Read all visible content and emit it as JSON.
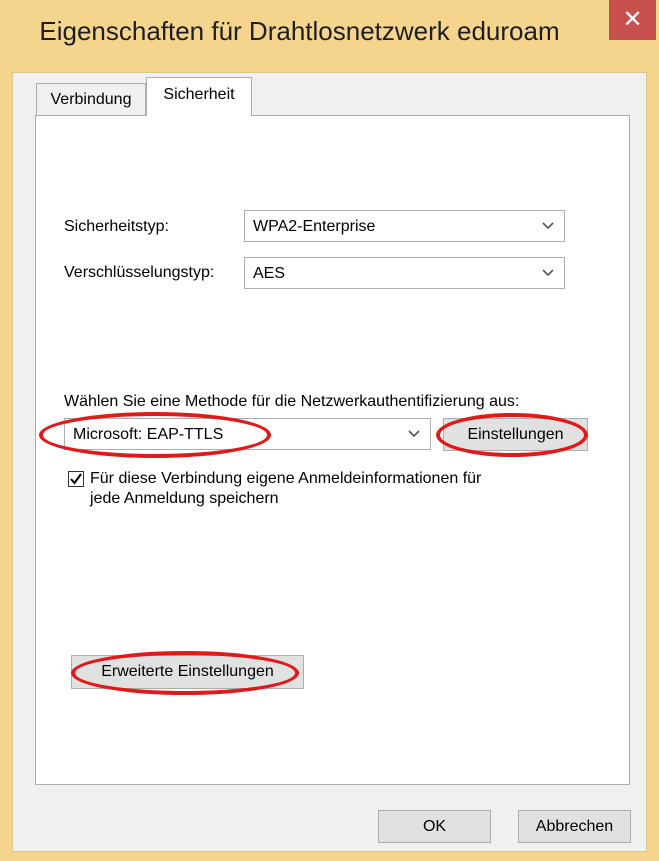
{
  "window": {
    "title": "Eigenschaften für Drahtlosnetzwerk eduroam",
    "close_glyph": "✕"
  },
  "tabs": [
    {
      "label": "Verbindung",
      "active": false
    },
    {
      "label": "Sicherheit",
      "active": true
    }
  ],
  "security": {
    "type_label": "Sicherheitstyp:",
    "type_value": "WPA2-Enterprise",
    "encryption_label": "Verschlüsselungstyp:",
    "encryption_value": "AES",
    "auth_label": "Wählen Sie eine Methode für die Netzwerkauthentifizierung aus:",
    "auth_value": "Microsoft: EAP-TTLS",
    "settings_button": "Einstellungen",
    "remember_checked": true,
    "remember_line1": "Für diese Verbindung eigene Anmeldeinformationen für",
    "remember_line2": "jede Anmeldung speichern",
    "advanced_button": "Erweiterte Einstellungen"
  },
  "footer": {
    "ok_label": "OK",
    "cancel_label": "Abbrechen"
  },
  "icons": {
    "chevron": "chevron-down-icon",
    "check": "checkmark-icon"
  },
  "colors": {
    "window_frame": "#f5d58e",
    "close_button": "#c7504d",
    "highlight_ring": "#e01a1a"
  }
}
